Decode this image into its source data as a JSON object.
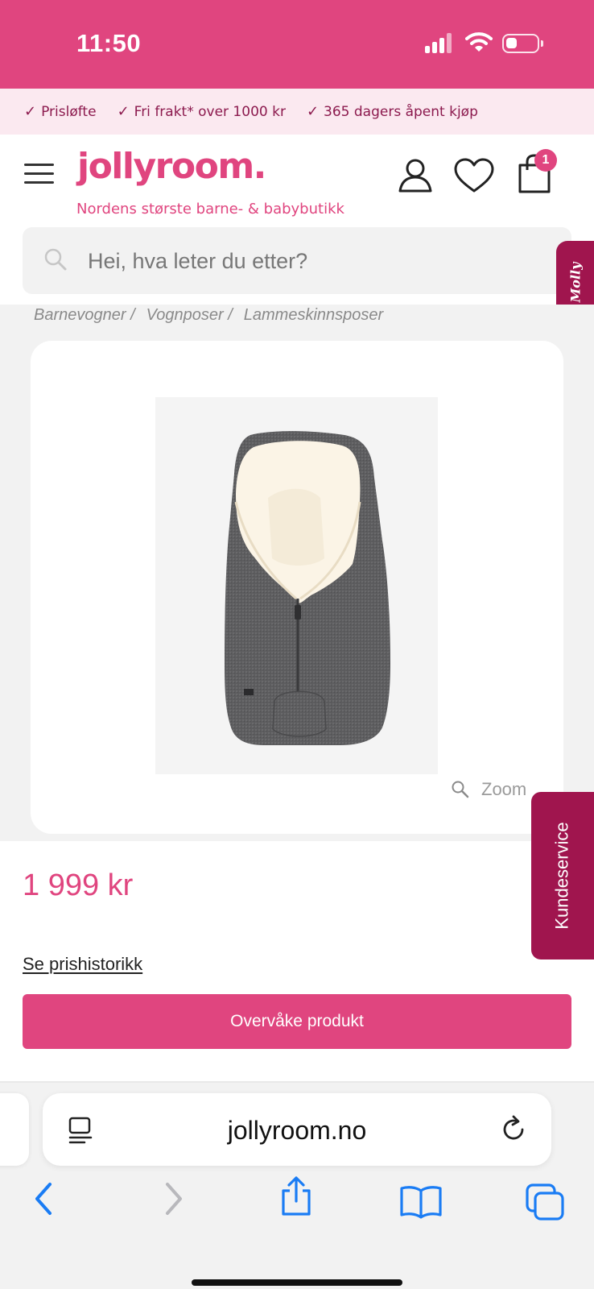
{
  "status_bar": {
    "time": "11:50"
  },
  "usp_bar": {
    "items": [
      "Prisløfte",
      "Fri frakt* over 1000 kr",
      "365 dagers åpent kjøp"
    ]
  },
  "header": {
    "logo": "jollyroom.",
    "tagline": "Nordens største barne- & babybutikk",
    "cart_count": "1"
  },
  "search": {
    "placeholder": "Hei, hva leter du etter?"
  },
  "chat_tab": {
    "label": "Molly"
  },
  "breadcrumb": [
    "Barnevogner /",
    "Vognposer /",
    "Lammeskinnsposer"
  ],
  "product": {
    "zoom_label": "Zoom",
    "price": "1 999 kr",
    "price_history_link": "Se prishistorikk",
    "watch_button": "Overvåke produkt"
  },
  "customer_service_tab": {
    "label": "Kundeservice"
  },
  "browser": {
    "url": "jollyroom.no"
  },
  "colors": {
    "brand_pink": "#e0457f",
    "dark_magenta": "#a0154e",
    "usp_text": "#8c1a4e",
    "ios_blue": "#1a7cf4"
  },
  "icons": [
    "signal-icon",
    "wifi-icon",
    "battery-icon",
    "check-icon",
    "menu-icon",
    "account-icon",
    "heart-icon",
    "cart-icon",
    "search-icon",
    "zoom-icon",
    "reader-icon",
    "reload-icon",
    "back-icon",
    "forward-icon",
    "share-icon",
    "bookmarks-icon",
    "tabs-icon"
  ]
}
